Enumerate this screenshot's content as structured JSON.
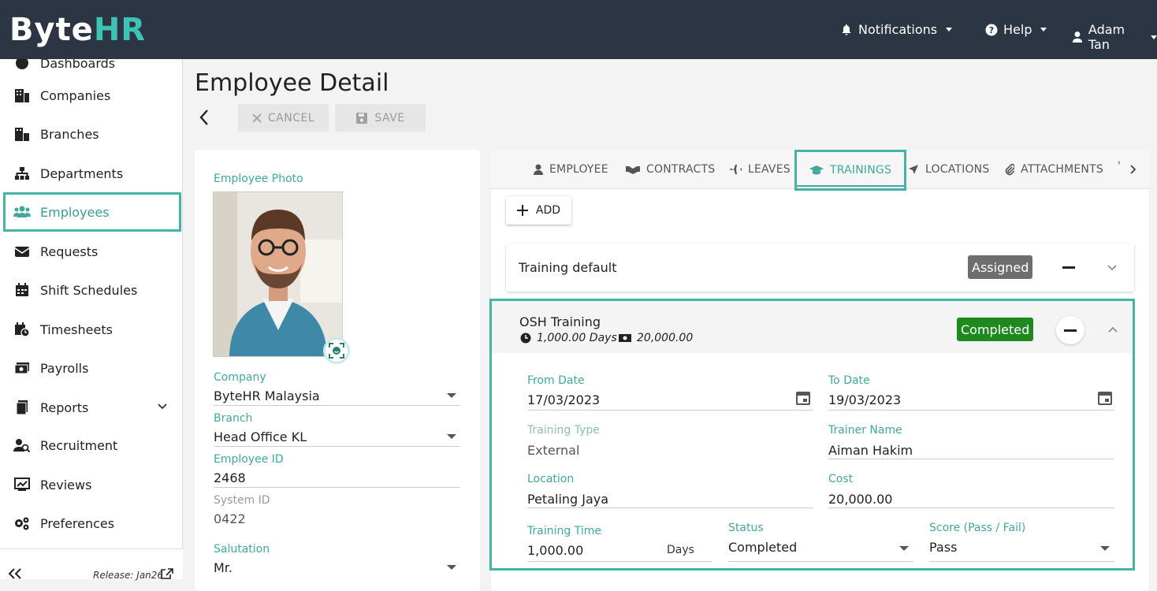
{
  "app": {
    "logo_left": "By",
    "logo_mid": "te",
    "logo_hr": "HR"
  },
  "topnav": {
    "notifications": "Notifications",
    "help": "Help",
    "user": "Adam Tan"
  },
  "sidebar": {
    "items": [
      {
        "label": "Dashboards"
      },
      {
        "label": "Companies"
      },
      {
        "label": "Branches"
      },
      {
        "label": "Departments"
      },
      {
        "label": "Employees"
      },
      {
        "label": "Requests"
      },
      {
        "label": "Shift Schedules"
      },
      {
        "label": "Timesheets"
      },
      {
        "label": "Payrolls"
      },
      {
        "label": "Reports"
      },
      {
        "label": "Recruitment"
      },
      {
        "label": "Reviews"
      },
      {
        "label": "Preferences"
      }
    ],
    "release": "Release: Jan26"
  },
  "page": {
    "title": "Employee Detail",
    "cancel": "CANCEL",
    "save": "SAVE"
  },
  "employee": {
    "photo_label": "Employee Photo",
    "company_label": "Company",
    "company": "ByteHR Malaysia",
    "branch_label": "Branch",
    "branch": "Head Office KL",
    "employee_id_label": "Employee ID",
    "employee_id": "2468",
    "system_id_label": "System ID",
    "system_id": "0422",
    "salutation_label": "Salutation",
    "salutation": "Mr."
  },
  "tabs": [
    {
      "label": "EMPLOYEE"
    },
    {
      "label": "CONTRACTS"
    },
    {
      "label": "LEAVES"
    },
    {
      "label": "TRAININGS"
    },
    {
      "label": "LOCATIONS"
    },
    {
      "label": "ATTACHMENTS"
    }
  ],
  "trainings": {
    "add": "ADD",
    "item1": {
      "name": "Training default",
      "status": "Assigned"
    },
    "item2": {
      "name": "OSH Training",
      "days": "1,000.00 Days",
      "cost_short": "20,000.00",
      "status": "Completed",
      "from_date_label": "From Date",
      "from_date": "17/03/2023",
      "to_date_label": "To Date",
      "to_date": "19/03/2023",
      "type_label": "Training Type",
      "type": "External",
      "trainer_label": "Trainer Name",
      "trainer": "Aiman Hakim",
      "location_label": "Location",
      "location": "Petaling Jaya",
      "cost_label": "Cost",
      "cost": "20,000.00",
      "time_label": "Training Time",
      "time": "1,000.00",
      "time_unit": "Days",
      "status_label": "Status",
      "status_value": "Completed",
      "score_label": "Score (Pass / Fail)",
      "score": "Pass"
    }
  },
  "colors": {
    "accent": "#45b3a5",
    "topbar": "#2b3543",
    "completed": "#1e8a1e",
    "assigned": "#6e6e6e"
  }
}
